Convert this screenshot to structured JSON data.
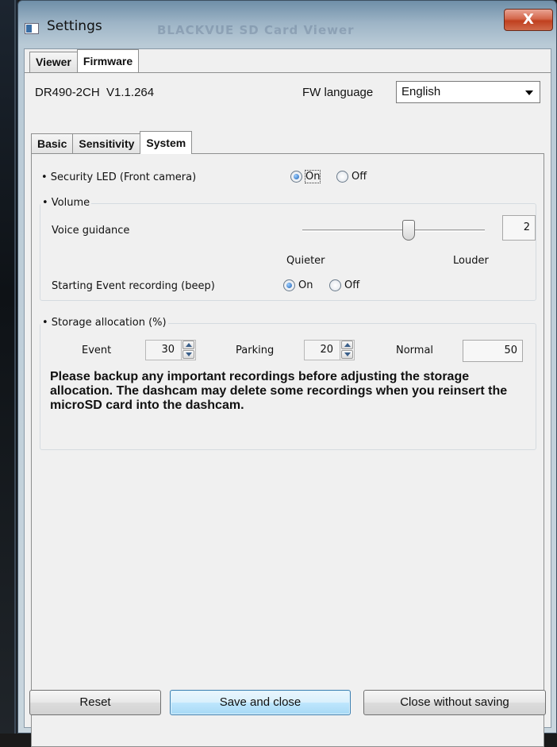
{
  "window": {
    "title": "Settings",
    "background_title": "BLACKVUE SD Card Viewer",
    "close_glyph": "X"
  },
  "top_tabs": [
    {
      "label": "Viewer",
      "active": false
    },
    {
      "label": "Firmware",
      "active": true
    }
  ],
  "firmware": {
    "model": "DR490-2CH",
    "version": "V1.1.264",
    "fw_language_label": "FW language",
    "fw_language_value": "English"
  },
  "sub_tabs": [
    {
      "label": "Basic",
      "active": false
    },
    {
      "label": "Sensitivity",
      "active": false
    },
    {
      "label": "System",
      "active": true
    }
  ],
  "system": {
    "security_led": {
      "label": "• Security LED (Front camera)",
      "on_label": "On",
      "off_label": "Off",
      "selected": "On"
    },
    "volume": {
      "title": "• Volume",
      "voice_guidance_label": "Voice guidance",
      "voice_guidance_value": "2",
      "slider_level": 2,
      "quieter_label": "Quieter",
      "louder_label": "Louder",
      "event_beep_label": "Starting Event recording (beep)",
      "event_beep_on_label": "On",
      "event_beep_off_label": "Off",
      "event_beep_selected": "On"
    },
    "storage": {
      "title": "• Storage allocation (%)",
      "event_label": "Event",
      "event_value": "30",
      "parking_label": "Parking",
      "parking_value": "20",
      "normal_label": "Normal",
      "normal_value": "50",
      "warning": "Please backup any important recordings before adjusting the storage allocation. The dashcam may delete some recordings when you reinsert the microSD card into the dashcam."
    }
  },
  "footer": {
    "reset_label": "Reset",
    "save_label": "Save and close",
    "close_label": "Close without saving"
  },
  "colors": {
    "accent": "#1a5fb4",
    "close_button": "#c0401f",
    "panel": "#f0f0f0"
  }
}
